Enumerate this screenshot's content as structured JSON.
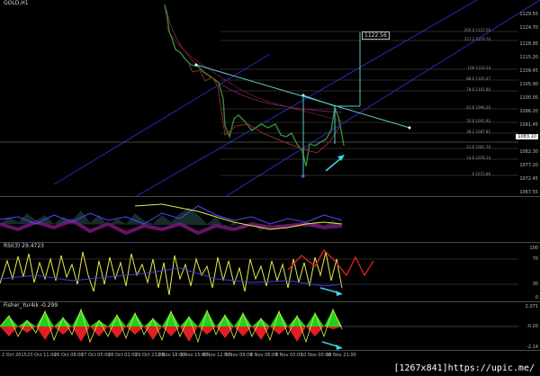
{
  "main": {
    "symbol_label": "GOLD,H1",
    "price_axis": [
      "1129.55",
      "1124.70",
      "1118.95",
      "1115.20",
      "1109.45",
      "1105.90",
      "1100.95",
      "1096.20",
      "1091.45",
      "1086.70",
      "1082.30",
      "1081.95",
      "1077.20",
      "1072.45",
      "1067.55"
    ],
    "current_price": "1083.10",
    "target_label": "1122.56",
    "fib_levels": [
      {
        "label": "200.0 1122.56"
      },
      {
        "label": "127.2 1119.76"
      },
      {
        "label": "100 1116.34"
      },
      {
        "label": "88.6 1105.47"
      },
      {
        "label": "78.6 1101.80"
      },
      {
        "label": "61.8 1096.20"
      },
      {
        "label": "50.0 1091.92"
      },
      {
        "label": "38.2 1087.85"
      },
      {
        "label": "23.6 1081.70"
      },
      {
        "label": "14.6 1076.14"
      },
      {
        "label": "0 1072.86"
      }
    ]
  },
  "rsi": {
    "label": "RSI(3) 29.4723",
    "axis": [
      "100",
      "70",
      "30",
      "0"
    ]
  },
  "fisher": {
    "label": "Fisher_Yur4ik -0.299",
    "axis": [
      "2.071",
      "-0.20",
      "-2.14"
    ]
  },
  "time_axis": [
    "2 Oct 2015",
    "23 Oct 11:00",
    "26 Oct 08:00",
    "27 Oct 05:00",
    "28 Oct 02:00",
    "29 Oct 23:00",
    "2 Nov 18:00",
    "3 Nov 15:00",
    "4 Nov 12:00",
    "5 Nov 09:00",
    "6 Nov 06:00",
    "9 Nov 03:00",
    "10 Nov 00:00",
    "10 Nov 21:00",
    "11 Nov 18:00",
    "12 Nov 15:00",
    "13 Nov 12:00",
    "16 Nov 09:00"
  ],
  "watermark": "[1267x841]https://upic.me/",
  "colors": {
    "line": "#e8e84a",
    "blue": "#3b3be8",
    "teal": "#30c8c8",
    "red": "#e02020",
    "green": "#20d020",
    "bull": "#00a000",
    "bear": "#c00000"
  }
}
